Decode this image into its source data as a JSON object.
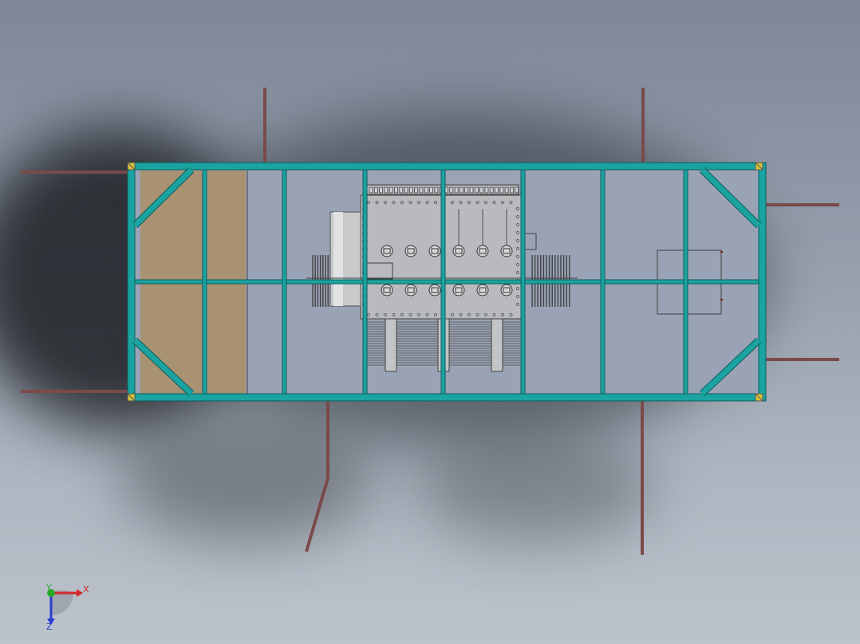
{
  "view": {
    "title": "",
    "background": {
      "top": "#7d8797",
      "bottom": "#bcc3cc"
    }
  },
  "colors": {
    "frame": "#1aa3a0",
    "frame_edge": "#0f5d5b",
    "floor": "#9aa3b6",
    "wood": "#a89272",
    "equipment": "#b8babd",
    "outline": "#404040",
    "outrigger": "#7a4a4a",
    "corner_plate": "#d8c23a"
  },
  "triad": {
    "x_label": "X",
    "y_label": "Y",
    "z_label": "Z",
    "x_color": "#d12a2a",
    "y_color": "#2aa82a",
    "z_color": "#2a3fd1"
  }
}
